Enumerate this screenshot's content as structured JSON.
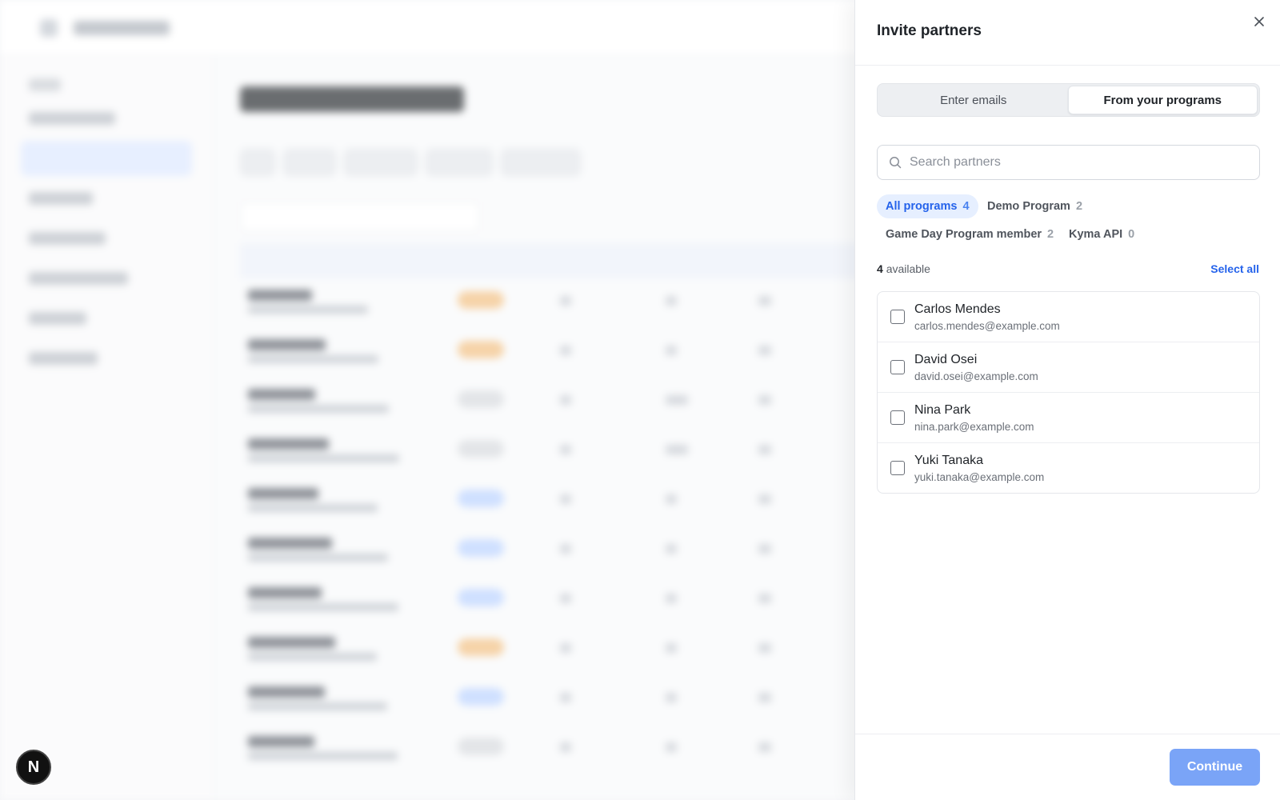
{
  "drawer": {
    "title": "Invite partners",
    "tabs": [
      {
        "label": "Enter emails",
        "active": false
      },
      {
        "label": "From your programs",
        "active": true
      }
    ],
    "search": {
      "placeholder": "Search partners",
      "value": ""
    },
    "program_filters": [
      {
        "label": "All programs",
        "count": "4",
        "active": true
      },
      {
        "label": "Demo Program",
        "count": "2",
        "active": false
      },
      {
        "label": "Game Day Program member",
        "count": "2",
        "active": false
      },
      {
        "label": "Kyma API",
        "count": "0",
        "active": false
      }
    ],
    "available_count": "4",
    "available_label": "available",
    "select_all_label": "Select all",
    "partners": [
      {
        "name": "Carlos Mendes",
        "email": "carlos.mendes@example.com",
        "checked": false
      },
      {
        "name": "David Osei",
        "email": "david.osei@example.com",
        "checked": false
      },
      {
        "name": "Nina Park",
        "email": "nina.park@example.com",
        "checked": false
      },
      {
        "name": "Yuki Tanaka",
        "email": "yuki.tanaka@example.com",
        "checked": false
      }
    ],
    "continue_label": "Continue"
  },
  "floating_badge": {
    "letter": "N"
  },
  "colors": {
    "accent": "#2563eb",
    "accent_soft": "#e6efff",
    "continue_disabled": "#7aa4f7"
  },
  "icons": {
    "close": "close-icon",
    "search": "search-icon"
  }
}
